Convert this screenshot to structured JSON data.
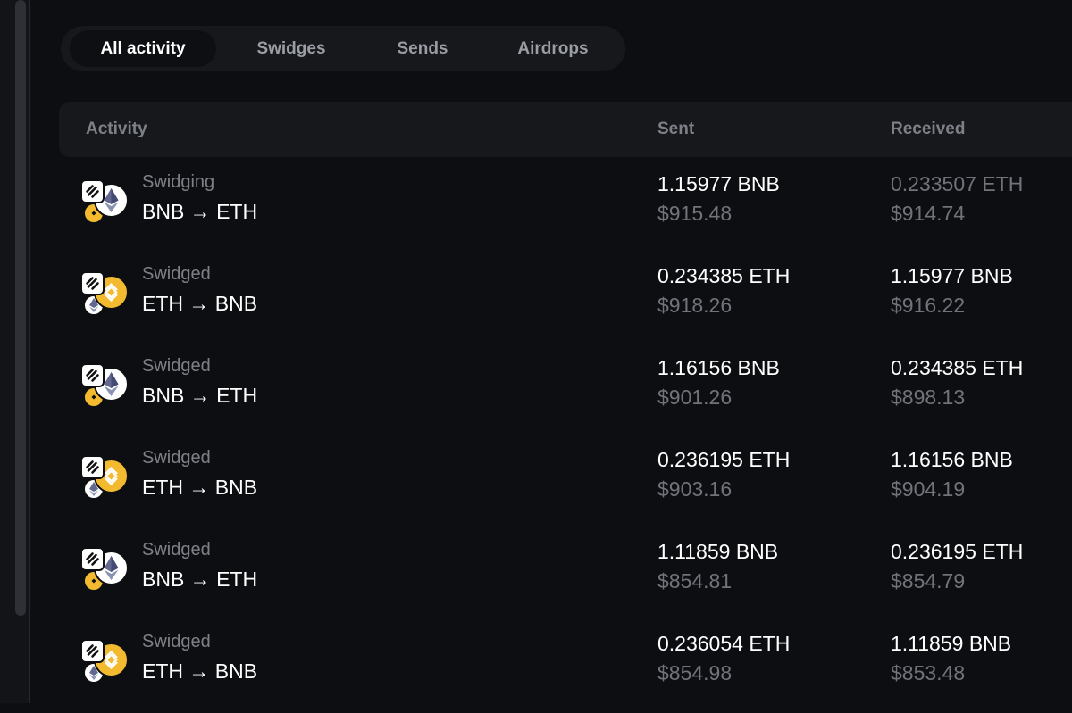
{
  "tabs": [
    {
      "label": "All activity",
      "active": true
    },
    {
      "label": "Swidges",
      "active": false
    },
    {
      "label": "Sends",
      "active": false
    },
    {
      "label": "Airdrops",
      "active": false
    }
  ],
  "table": {
    "headers": {
      "activity": "Activity",
      "sent": "Sent",
      "received": "Received"
    },
    "rows": [
      {
        "status": "Swidging",
        "pair": "BNB → ETH",
        "sent_amount": "1.15977 BNB",
        "sent_usd": "$915.48",
        "received_amount": "0.233507 ETH",
        "received_usd": "$914.74",
        "icon": "bnb-to-eth"
      },
      {
        "status": "Swidged",
        "pair": "ETH → BNB",
        "sent_amount": "0.234385 ETH",
        "sent_usd": "$918.26",
        "received_amount": "1.15977 BNB",
        "received_usd": "$916.22",
        "icon": "eth-to-bnb"
      },
      {
        "status": "Swidged",
        "pair": "BNB → ETH",
        "sent_amount": "1.16156 BNB",
        "sent_usd": "$901.26",
        "received_amount": "0.234385 ETH",
        "received_usd": "$898.13",
        "icon": "bnb-to-eth"
      },
      {
        "status": "Swidged",
        "pair": "ETH → BNB",
        "sent_amount": "0.236195 ETH",
        "sent_usd": "$903.16",
        "received_amount": "1.16156 BNB",
        "received_usd": "$904.19",
        "icon": "eth-to-bnb"
      },
      {
        "status": "Swidged",
        "pair": "BNB → ETH",
        "sent_amount": "1.11859 BNB",
        "sent_usd": "$854.81",
        "received_amount": "0.236195 ETH",
        "received_usd": "$854.79",
        "icon": "bnb-to-eth"
      },
      {
        "status": "Swidged",
        "pair": "ETH → BNB",
        "sent_amount": "0.236054 ETH",
        "sent_usd": "$854.98",
        "received_amount": "1.11859 BNB",
        "received_usd": "$853.48",
        "icon": "eth-to-bnb"
      }
    ]
  },
  "colors": {
    "background": "#0d0e11",
    "panel": "#16181c",
    "muted_text": "#7d8087",
    "bnb": "#f3ba2f",
    "eth_logo": "#62688f"
  }
}
